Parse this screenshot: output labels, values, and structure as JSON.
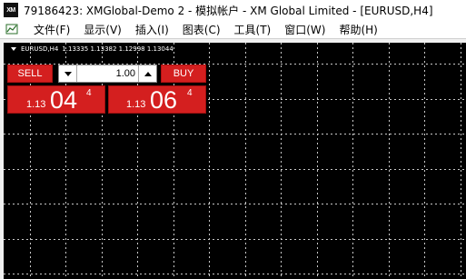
{
  "window": {
    "app_icon": "XM",
    "title": "79186423: XMGlobal-Demo 2 - 模拟帐户 - XM Global Limited - [EURUSD,H4]"
  },
  "menu": {
    "items": [
      "文件(F)",
      "显示(V)",
      "插入(I)",
      "图表(C)",
      "工具(T)",
      "窗口(W)",
      "帮助(H)"
    ]
  },
  "chart": {
    "symbol": "EURUSD,H4",
    "ohlc": "1.13335 1.13382 1.12998 1.13044",
    "background_color": "#000000",
    "grid_color": "#c8c8c8"
  },
  "trade_panel": {
    "sell_label": "SELL",
    "buy_label": "BUY",
    "lot_value": "1.00",
    "sell_price": {
      "prefix": "1.13",
      "big": "04",
      "sup": "4"
    },
    "buy_price": {
      "prefix": "1.13",
      "big": "06",
      "sup": "4"
    },
    "accent_color": "#d41f1f"
  }
}
